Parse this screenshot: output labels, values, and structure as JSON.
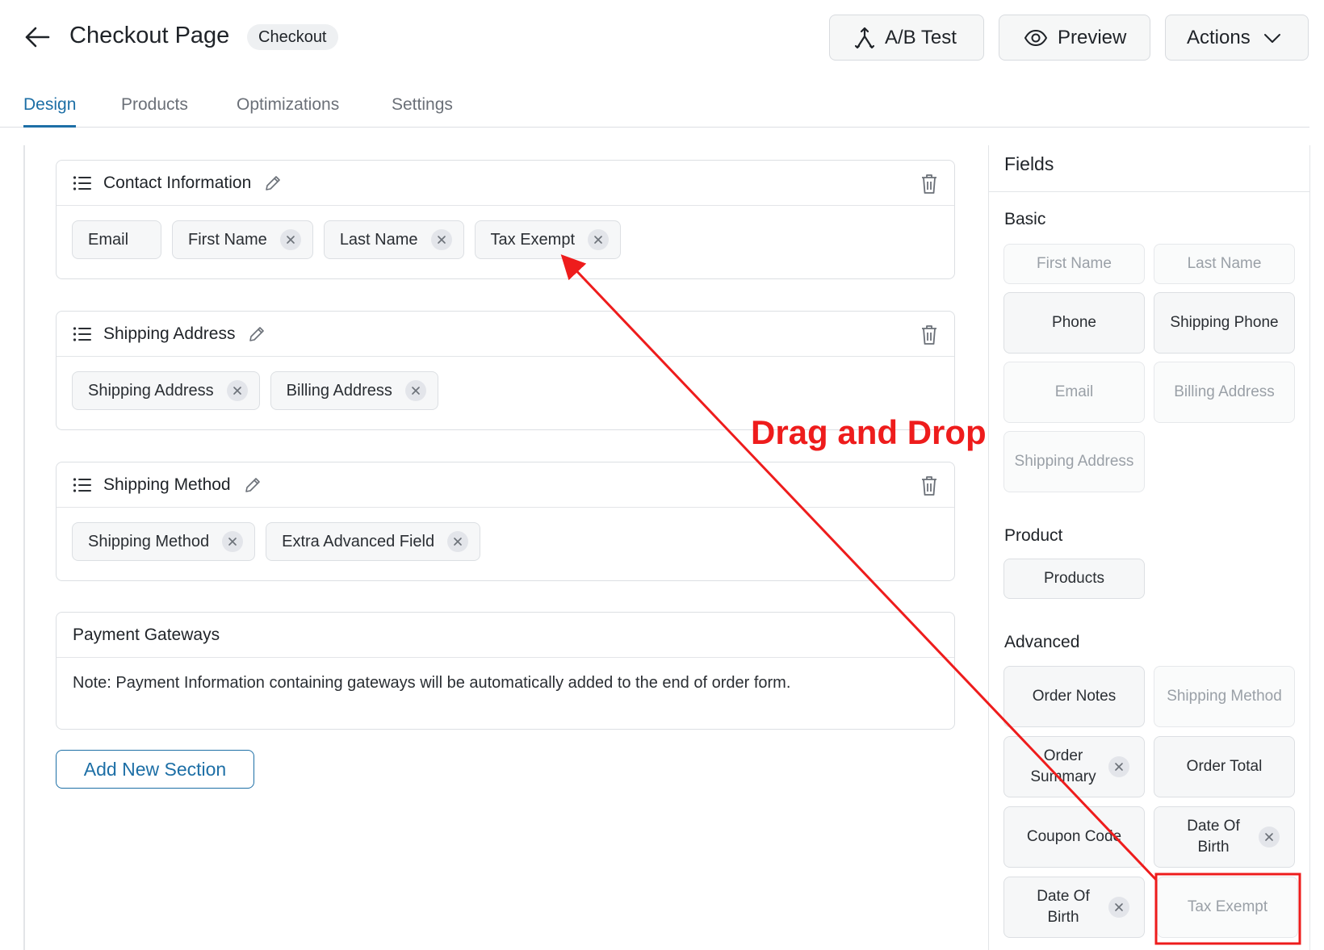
{
  "header": {
    "title": "Checkout Page",
    "badge": "Checkout",
    "ab_test_label": "A/B Test",
    "preview_label": "Preview",
    "actions_label": "Actions"
  },
  "tabs": [
    {
      "label": "Design",
      "active": true
    },
    {
      "label": "Products",
      "active": false
    },
    {
      "label": "Optimizations",
      "active": false
    },
    {
      "label": "Settings",
      "active": false
    }
  ],
  "sections": [
    {
      "title": "Contact Information",
      "chips": [
        "Email",
        "First Name",
        "Last Name",
        "Tax Exempt"
      ]
    },
    {
      "title": "Shipping Address",
      "chips": [
        "Shipping Address",
        "Billing Address"
      ]
    },
    {
      "title": "Shipping Method",
      "chips": [
        "Shipping Method",
        "Extra Advanced Field"
      ]
    }
  ],
  "payment": {
    "title": "Payment Gateways",
    "note": "Note: Payment Information containing gateways will be automatically added to the end of order form."
  },
  "add_section_label": "Add New Section",
  "fields_panel": {
    "title": "Fields",
    "groups": {
      "basic": {
        "label": "Basic",
        "items": [
          "First Name",
          "Last Name",
          "Phone",
          "Shipping Phone",
          "Email",
          "Billing Address",
          "Shipping Address"
        ]
      },
      "product": {
        "label": "Product",
        "items": [
          "Products"
        ]
      },
      "advanced": {
        "label": "Advanced",
        "items": [
          "Order Notes",
          "Shipping Method",
          "Order Summary",
          "Order Total",
          "Coupon Code",
          "Date Of Birth",
          "Date Of Birth",
          "Tax Exempt"
        ]
      }
    }
  },
  "annotation": {
    "label": "Drag and Drop",
    "color": "#ee1c1c"
  },
  "colors": {
    "accent": "#1d6fa6",
    "annotation": "#ee1c1c"
  }
}
